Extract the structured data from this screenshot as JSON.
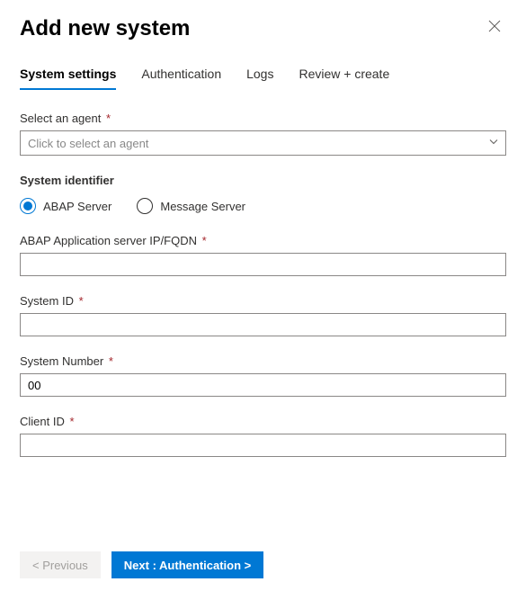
{
  "header": {
    "title": "Add new system"
  },
  "tabs": [
    {
      "label": "System settings",
      "active": true
    },
    {
      "label": "Authentication",
      "active": false
    },
    {
      "label": "Logs",
      "active": false
    },
    {
      "label": "Review + create",
      "active": false
    }
  ],
  "fields": {
    "select_agent": {
      "label": "Select an agent",
      "required": "*",
      "placeholder": "Click to select an agent"
    },
    "system_identifier_label": "System identifier",
    "radios": {
      "abap": "ABAP Server",
      "message": "Message Server"
    },
    "abap_server": {
      "label": "ABAP Application server IP/FQDN",
      "required": "*",
      "value": ""
    },
    "system_id": {
      "label": "System ID",
      "required": "*",
      "value": ""
    },
    "system_number": {
      "label": "System Number",
      "required": "*",
      "value": "00"
    },
    "client_id": {
      "label": "Client ID",
      "required": "*",
      "value": ""
    }
  },
  "footer": {
    "previous": "< Previous",
    "next": "Next : Authentication  >"
  }
}
